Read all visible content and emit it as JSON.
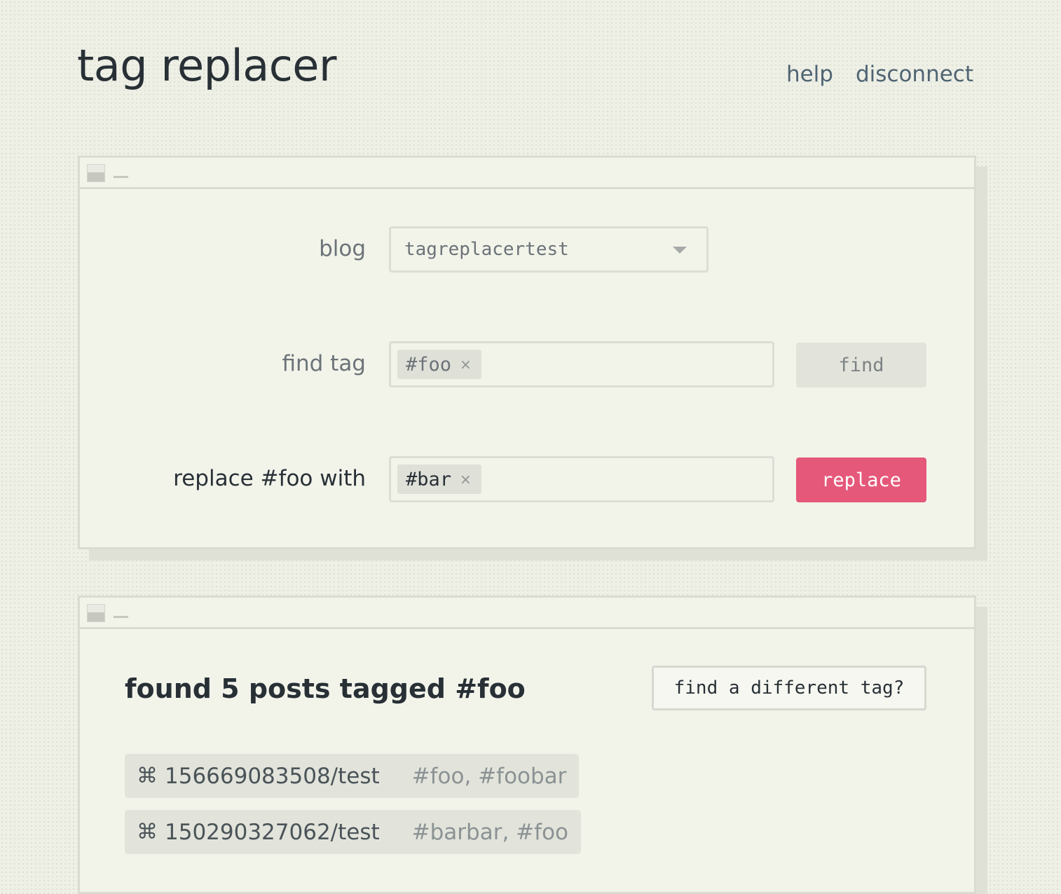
{
  "header": {
    "title": "tag replacer",
    "nav": [
      "help",
      "disconnect"
    ]
  },
  "form": {
    "blog_label": "blog",
    "blog_value": "tagreplacertest",
    "find_label": "find tag",
    "find_tag": "#foo",
    "find_button": "find",
    "replace_label": "replace #foo with",
    "replace_tag": "#bar",
    "replace_button": "replace",
    "chip_remove": "×"
  },
  "results": {
    "heading": "found 5 posts tagged #foo",
    "different_tag_button": "find a different tag?",
    "posts": [
      {
        "icon": "⌘",
        "id": "156669083508/test",
        "tags": "#foo, #foobar"
      },
      {
        "icon": "⌘",
        "id": "150290327062/test",
        "tags": "#barbar, #foo"
      }
    ]
  },
  "colors": {
    "accent": "#e5587a",
    "background": "#eef0e6",
    "panel": "#f2f4ea",
    "nav_link": "#4f6473"
  },
  "icons": {
    "window_icon": "window-icon",
    "minimize_icon": "minimize-icon",
    "dropdown_icon": "caret-down-icon",
    "post_icon": "command-icon"
  }
}
